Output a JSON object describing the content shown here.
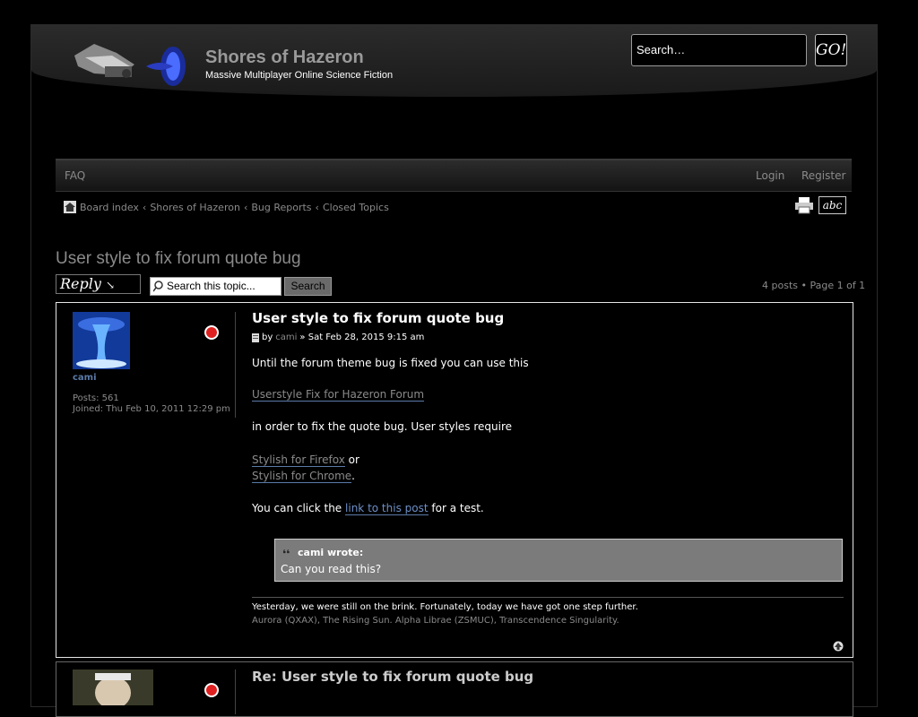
{
  "header": {
    "site_title": "Shores of Hazeron",
    "site_description": "Massive Multiplayer Online Science Fiction",
    "search_placeholder": "Search…",
    "go_label": "GO!"
  },
  "navbar": {
    "faq": "FAQ",
    "login": "Login",
    "register": "Register"
  },
  "breadcrumb": [
    "Board index",
    "Shores of Hazeron",
    "Bug Reports",
    "Closed Topics"
  ],
  "breadcrumb_sep": "‹",
  "font_toggle_label": "abc",
  "topic": {
    "title": "User style to fix forum quote bug",
    "reply_label": "Reply",
    "search_placeholder": "Search this topic...",
    "search_button": "Search",
    "pagination": "4 posts • Page 1 of 1"
  },
  "post": {
    "title": "User style to fix forum quote bug",
    "by": "by",
    "author": "cami",
    "date": "» Sat Feb 28, 2015 9:15 am",
    "username": "cami",
    "posts": "Posts: 561",
    "joined": "Joined: Thu Feb 10, 2011 12:29 pm",
    "line1": "Until the forum theme bug is fixed you can use this",
    "link1": "Userstyle Fix for Hazeron Forum",
    "line2": "in order to fix the quote bug. User styles require",
    "link2": "Stylish for Firefox",
    "or_text": "or",
    "link3": "Stylish for Chrome",
    "period": ".",
    "click_prefix": "You can click the",
    "link4": "link to this post",
    "click_suffix": "for a test.",
    "quote_author": "cami wrote:",
    "quote_text": "Can you read this?",
    "sig1": "Yesterday, we were still on the brink. Fortunately, today we have got one step further.",
    "sig2": "Aurora (QXAX), The Rising Sun. Alpha Librae (ZSMUC), Transcendence Singularity."
  },
  "post2": {
    "title": "Re: User style to fix forum quote bug"
  },
  "colors": {
    "link_blue": "#6d8fc7",
    "status_red": "#e02020",
    "quote_bg": "#7b7b7b"
  }
}
